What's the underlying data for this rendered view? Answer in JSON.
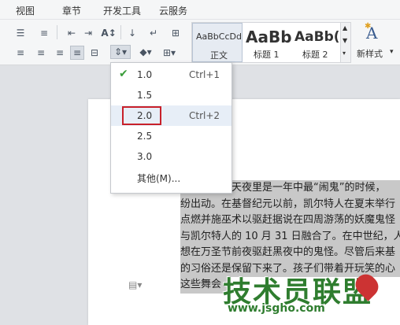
{
  "ribbon": {
    "tabs": [
      "视图",
      "章节",
      "开发工具",
      "云服务"
    ],
    "styles": [
      {
        "preview": "AaBbCcDd",
        "name": "正文"
      },
      {
        "preview": "AaBb",
        "name": "标题 1"
      },
      {
        "preview": "AaBb(",
        "name": "标题 2"
      }
    ],
    "new_style_label": "新样式",
    "new_style_icon_text": "A"
  },
  "line_spacing_menu": {
    "items": [
      {
        "label": "1.0",
        "shortcut": "Ctrl+1",
        "checked": true
      },
      {
        "label": "1.5",
        "shortcut": ""
      },
      {
        "label": "2.0",
        "shortcut": "Ctrl+2",
        "highlighted": true
      },
      {
        "label": "2.5",
        "shortcut": ""
      },
      {
        "label": "3.0",
        "shortcut": ""
      },
      {
        "label": "其他(M)...",
        "shortcut": ""
      }
    ]
  },
  "document": {
    "lines": [
      "万圣节前一天夜里是一年中最“闹鬼”的时候，",
      "纷出动。在基督纪元以前，凯尔特人在夏末举行",
      "点燃并施巫术以驱赶据说在四周游荡的妖魔鬼怪",
      "与凯尔特人的 10 月 31 日融合了。在中世纪，人",
      "想在万圣节前夜驱赶黑夜中的鬼怪。尽管后来基",
      "的习俗还是保留下来了。孩子们带着开玩笑的心",
      "这些舞会"
    ]
  },
  "watermark": {
    "text": "技术员联盟",
    "url": "www.jsgho.com"
  },
  "colors": {
    "accent_check": "#3a9d3a",
    "highlight_border": "#c8202a",
    "menu_hover": "#e7eef7",
    "watermark": "#2f7d2f"
  }
}
